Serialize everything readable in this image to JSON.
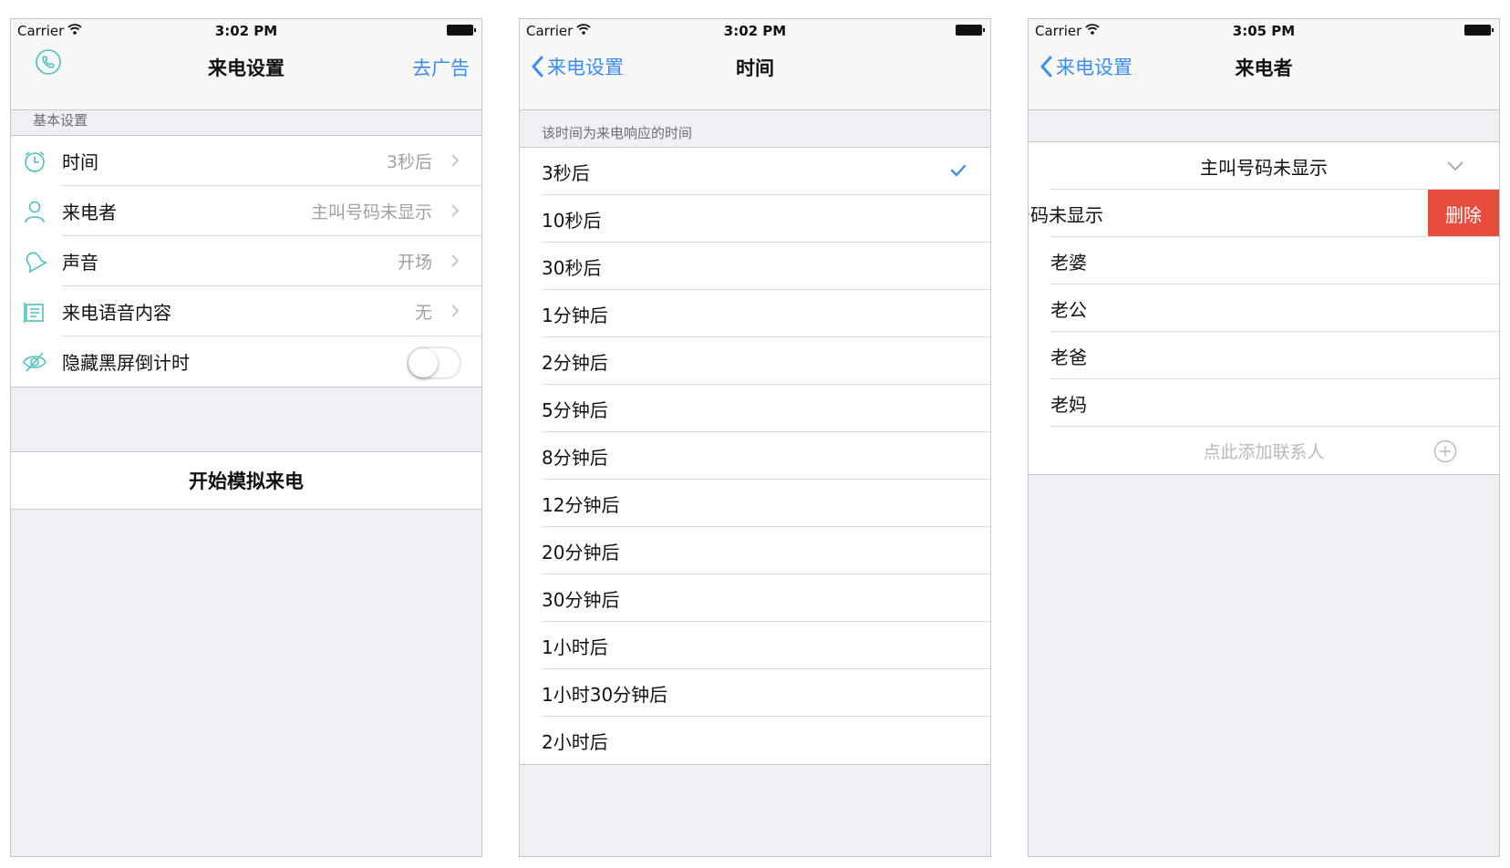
{
  "colors": {
    "accent": "#3b8ef0",
    "icon_teal": "#4cc0c0",
    "destructive": "#e74c3c"
  },
  "screen1": {
    "status": {
      "carrier": "Carrier",
      "time": "3:02 PM"
    },
    "nav": {
      "title": "来电设置",
      "right_label": "去广告",
      "logo_icon": "phone-handset-icon"
    },
    "section_header": "基本设置",
    "rows": [
      {
        "icon": "clock-icon",
        "label": "时间",
        "value": "3秒后"
      },
      {
        "icon": "person-icon",
        "label": "来电者",
        "value": "主叫号码未显示"
      },
      {
        "icon": "bell-icon",
        "label": "声音",
        "value": "开场"
      },
      {
        "icon": "document-icon",
        "label": "来电语音内容",
        "value": "无"
      }
    ],
    "toggle_row": {
      "icon": "eye-slash-icon",
      "label": "隐藏黑屏倒计时",
      "on": false
    },
    "start_button": "开始模拟来电"
  },
  "screen2": {
    "status": {
      "carrier": "Carrier",
      "time": "3:02 PM"
    },
    "nav": {
      "back_label": "来电设置",
      "title": "时间"
    },
    "section_header": "该时间为来电响应的时间",
    "options": [
      "3秒后",
      "10秒后",
      "30秒后",
      "1分钟后",
      "2分钟后",
      "5分钟后",
      "8分钟后",
      "12分钟后",
      "20分钟后",
      "30分钟后",
      "1小时后",
      "1小时30分钟后",
      "2小时后"
    ],
    "selected": "3秒后"
  },
  "screen3": {
    "status": {
      "carrier": "Carrier",
      "time": "3:05 PM"
    },
    "nav": {
      "back_label": "来电设置",
      "title": "来电者"
    },
    "dropdown": "主叫号码未显示",
    "swiped_row": {
      "label": "号码未显示",
      "delete_label": "删除"
    },
    "contacts": [
      "老婆",
      "老公",
      "老爸",
      "老妈"
    ],
    "add_contact": "点此添加联系人"
  }
}
